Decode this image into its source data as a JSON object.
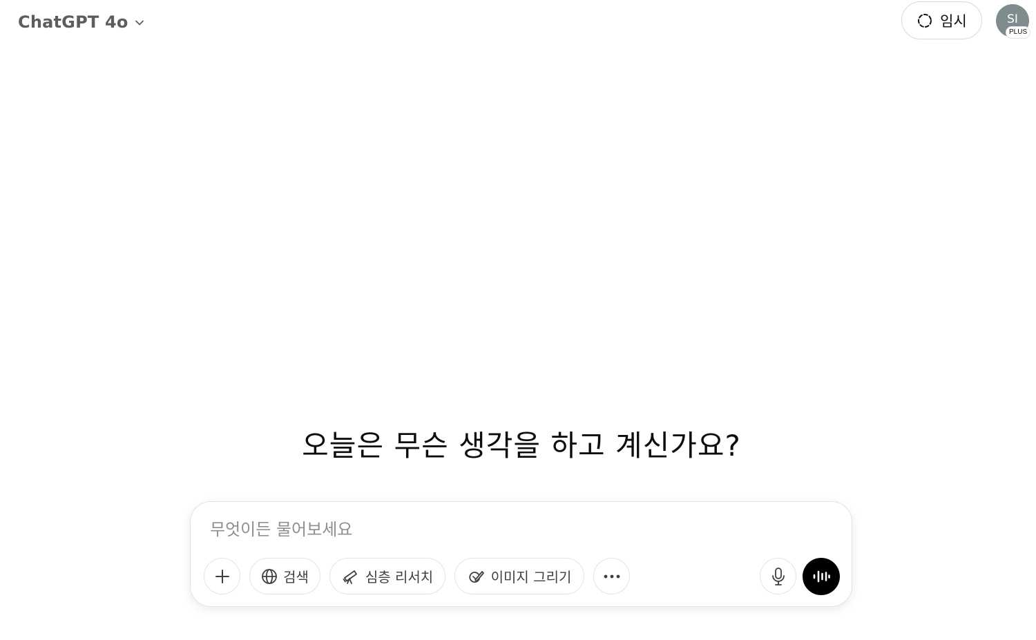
{
  "header": {
    "model_name": "ChatGPT 4o",
    "temporary_label": "임시",
    "avatar_initials": "SI",
    "plan_badge": "PLUS"
  },
  "main": {
    "headline": "오늘은 무슨 생각을 하고 계신가요?"
  },
  "composer": {
    "placeholder": "무엇이든 물어보세요",
    "value": "",
    "tools": {
      "add_icon": "plus-icon",
      "search_label": "검색",
      "search_icon": "globe-icon",
      "deep_research_label": "심층 리서치",
      "deep_research_icon": "telescope-icon",
      "image_label": "이미지 그리기",
      "image_icon": "paint-brush-icon",
      "more_icon": "ellipsis-icon"
    },
    "mic_icon": "microphone-icon",
    "voice_icon": "voice-waveform-icon"
  },
  "colors": {
    "background": "#ffffff",
    "text": "#0d0d0d",
    "model_name": "#5d5d5d",
    "placeholder": "#8f8f8f",
    "border": "#e3e3e3",
    "avatar": "#7f8c8d",
    "voice_button": "#000000"
  }
}
